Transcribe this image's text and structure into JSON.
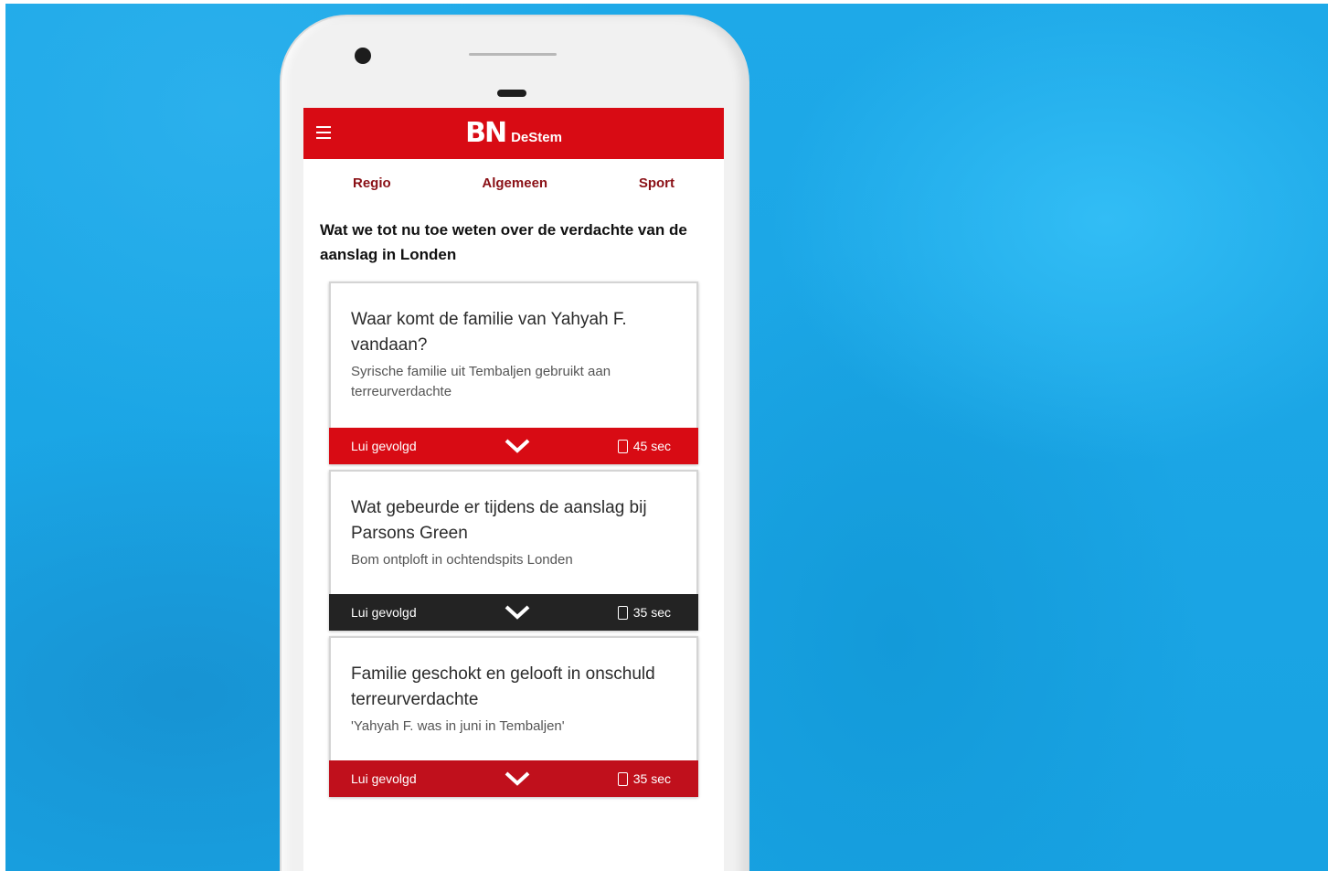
{
  "app": {
    "logo_mark": "BN",
    "logo_sub": "DeStem"
  },
  "tabs": [
    {
      "label": "Regio"
    },
    {
      "label": "Algemeen"
    },
    {
      "label": "Sport"
    }
  ],
  "article": {
    "headline": "Wat we tot nu toe weten over de verdachte van de aanslag in Londen"
  },
  "cards": [
    {
      "question": "Waar komt de familie van Yahyah F. vandaan?",
      "answer": "Syrische familie uit Tembaljen gebruikt aan terreurverdachte",
      "action": "Lui gevolgd",
      "duration": "45 sec",
      "bar_color": "#d80b14"
    },
    {
      "question": "Wat gebeurde er tijdens de aanslag bij Parsons Green",
      "answer": "Bom ontploft in ochtendspits Londen",
      "action": "Lui gevolgd",
      "duration": "35 sec",
      "bar_color": "#232323"
    },
    {
      "question": "Familie geschokt en gelooft in onschuld terreurverdachte",
      "answer": "'Yahyah F. was in juni in Tembaljen'",
      "action": "Lui gevolgd",
      "duration": "35 sec",
      "bar_color": "#c0101c"
    }
  ],
  "colors": {
    "background": "#1aa7e6",
    "brand_red": "#d80b14",
    "tab_text": "#8a1016"
  },
  "icons": {
    "menu": "hamburger-menu-icon",
    "camera": "front-camera",
    "expand": "chevron-down-icon",
    "duration": "timer-icon"
  }
}
